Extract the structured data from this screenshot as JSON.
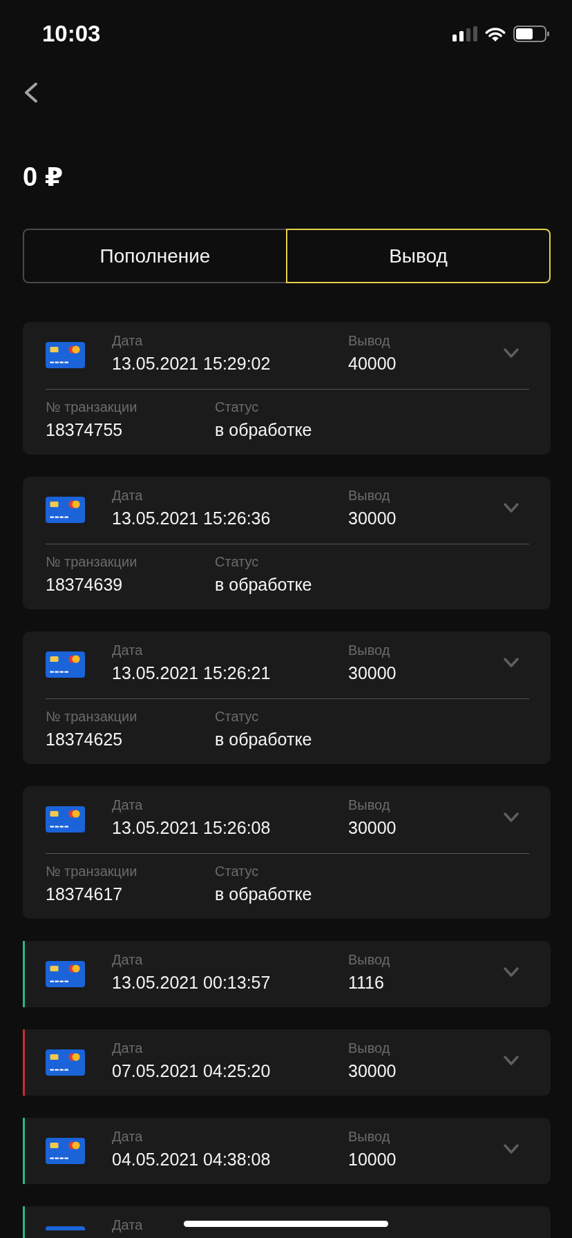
{
  "status_bar": {
    "time": "10:03"
  },
  "balance": "0 ₽",
  "tabs": [
    {
      "label": "Пополнение",
      "selected": false
    },
    {
      "label": "Вывод",
      "selected": true
    }
  ],
  "transactions": [
    {
      "date_label": "Дата",
      "date": "13.05.2021 15:29:02",
      "amount_label": "Вывод",
      "amount": "40000",
      "id_label": "№ транзакции",
      "id": "18374755",
      "status_label": "Статус",
      "status": "в обработке"
    },
    {
      "date_label": "Дата",
      "date": "13.05.2021 15:26:36",
      "amount_label": "Вывод",
      "amount": "30000",
      "id_label": "№ транзакции",
      "id": "18374639",
      "status_label": "Статус",
      "status": "в обработке"
    },
    {
      "date_label": "Дата",
      "date": "13.05.2021 15:26:21",
      "amount_label": "Вывод",
      "amount": "30000",
      "id_label": "№ транзакции",
      "id": "18374625",
      "status_label": "Статус",
      "status": "в обработке"
    },
    {
      "date_label": "Дата",
      "date": "13.05.2021 15:26:08",
      "amount_label": "Вывод",
      "amount": "30000",
      "id_label": "№ транзакции",
      "id": "18374617",
      "status_label": "Статус",
      "status": "в обработке"
    },
    {
      "color": "#2bb784",
      "date_label": "Дата",
      "date": "13.05.2021 00:13:57",
      "amount_label": "Вывод",
      "amount": "1116"
    },
    {
      "color": "#cc2a3a",
      "date_label": "Дата",
      "date": "07.05.2021 04:25:20",
      "amount_label": "Вывод",
      "amount": "30000"
    },
    {
      "color": "#2bb784",
      "date_label": "Дата",
      "date": "04.05.2021 04:38:08",
      "amount_label": "Вывод",
      "amount": "10000"
    }
  ],
  "cut_off_item": {
    "color": "#2bb784",
    "date_label": "Дата"
  }
}
